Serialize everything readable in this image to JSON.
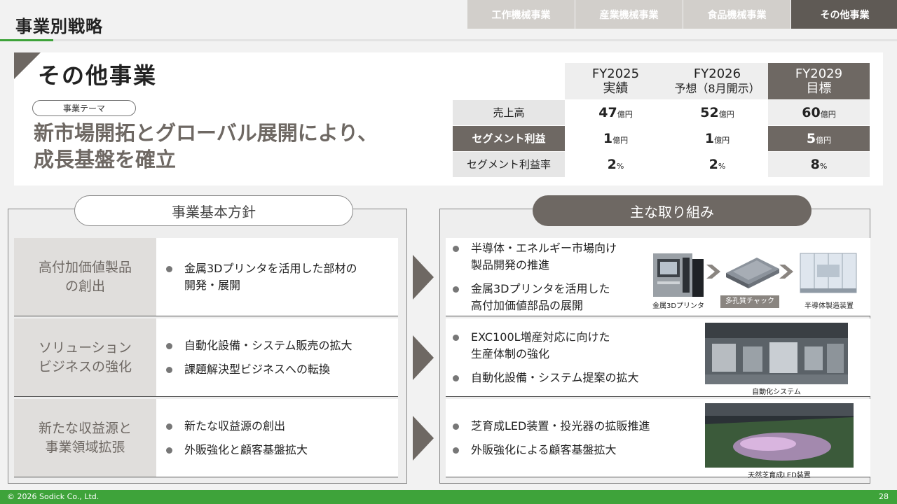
{
  "header": {
    "title": "事業別戦略",
    "tabs": [
      "工作機械事業",
      "産業機械事業",
      "食品機械事業",
      "その他事業"
    ],
    "active_tab": 3
  },
  "hero": {
    "title": "その他事業",
    "theme_label": "事業テーマ",
    "theme_line1": "新市場開拓とグローバル展開により、",
    "theme_line2": "成長基盤を確立"
  },
  "fin_table": {
    "columns": [
      {
        "l1": "FY2025",
        "l2": "実績"
      },
      {
        "l1": "FY2026",
        "l2": "予想（8月開示）"
      },
      {
        "l1": "FY2029",
        "l2": "目標"
      }
    ],
    "rows": [
      {
        "label": "売上高",
        "values": [
          "47",
          "52",
          "60"
        ],
        "unit": "億円"
      },
      {
        "label": "セグメント利益",
        "values": [
          "1",
          "1",
          "5"
        ],
        "unit": "億円"
      },
      {
        "label": "セグメント利益率",
        "values": [
          "2",
          "2",
          "8"
        ],
        "unit": "%"
      }
    ]
  },
  "policy": {
    "header": "事業基本方針",
    "rows": [
      {
        "category_l1": "高付加価値製品",
        "category_l2": "の創出",
        "points": [
          "金属3Dプリンタを活用した部材の",
          "開発・展開"
        ]
      },
      {
        "category_l1": "ソリューション",
        "category_l2": "ビジネスの強化",
        "points": [
          "自動化設備・システム販売の拡大",
          "課題解決型ビジネスへの転換"
        ]
      },
      {
        "category_l1": "新たな収益源と",
        "category_l2": "事業領域拡張",
        "points": [
          "新たな収益源の創出",
          "外販強化と顧客基盤拡大"
        ]
      }
    ]
  },
  "initiatives": {
    "header": "主な取り組み",
    "rows": [
      {
        "points": [
          [
            "半導体・エネルギー市場向け",
            "製品開発の推進"
          ],
          [
            "金属3Dプリンタを活用した",
            "高付加価値部品の展開"
          ]
        ],
        "captions": [
          "金属3Dプリンタ",
          "多孔質チャック",
          "半導体製造装置"
        ]
      },
      {
        "points": [
          [
            "EXC100L増産対応に向けた",
            "生産体制の強化"
          ],
          [
            "自動化設備・システム提案の拡大"
          ]
        ],
        "captions": [
          "自動化システム"
        ]
      },
      {
        "points": [
          [
            "芝育成LED装置・投光器の拡販推進"
          ],
          [
            "外販強化による顧客基盤拡大"
          ]
        ],
        "captions": [
          "天然芝育成LED装置"
        ]
      }
    ]
  },
  "footer": {
    "copyright": "© 2026 Sodick Co., Ltd.",
    "page": "28"
  },
  "colors": {
    "accent_green": "#3ea33a",
    "brand_gray": "#6e6863",
    "tab_gray": "#d2cfcb"
  }
}
